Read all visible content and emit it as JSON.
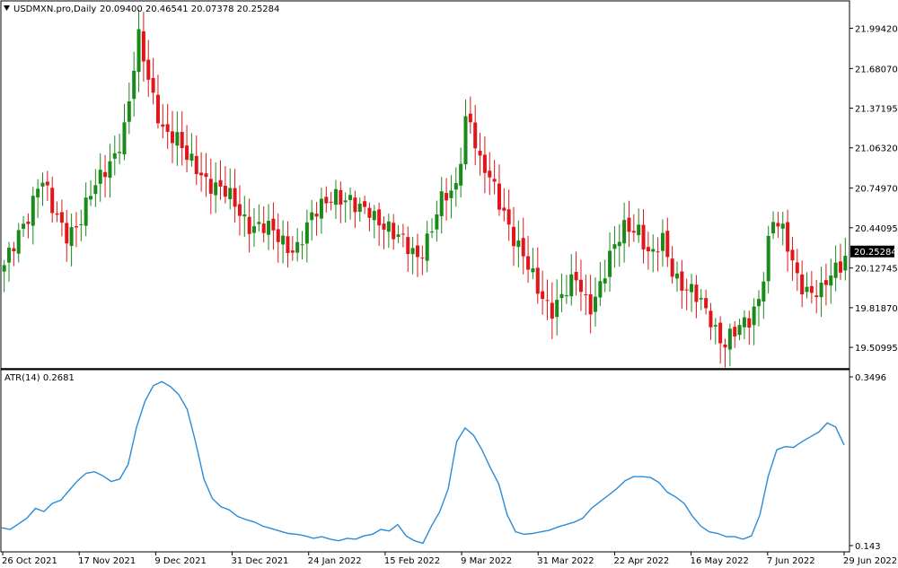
{
  "header": {
    "symbol_line": "USDMXN.pro,Daily",
    "ohlc": "20.09400 20.46541 20.07378 20.25284",
    "menu_icon": "triangle-down-icon"
  },
  "indicator": {
    "label": "ATR(14) 0.2681"
  },
  "colors": {
    "bull": "#1a8a1a",
    "bear": "#e0161b",
    "atr_line": "#2a8bd6",
    "price_tag_bg": "#000000",
    "price_tag_text": "#ffffff",
    "frame": "#000000"
  },
  "chart_data": [
    {
      "type": "candlestick",
      "title": "USDMXN.pro,Daily",
      "ylim": [
        19.35,
        22.2
      ],
      "y_ticks": [
        "21.99420",
        "21.68070",
        "21.37195",
        "21.06320",
        "20.74970",
        "20.44095",
        "20.12745",
        "19.81870",
        "19.50995"
      ],
      "y_tick_values": [
        21.9942,
        21.6807,
        21.37195,
        21.0632,
        20.7497,
        20.44095,
        20.12745,
        19.8187,
        19.50995
      ],
      "current_price": "20.25284",
      "current_price_value": 20.25284,
      "x_labels": [
        "26 Oct 2021",
        "17 Nov 2021",
        "9 Dec 2021",
        "31 Dec 2021",
        "24 Jan 2022",
        "15 Feb 2022",
        "9 Mar 2022",
        "31 Mar 2022",
        "22 Apr 2022",
        "16 May 2022",
        "7 Jun 2022",
        "29 Jun 2022"
      ],
      "close_path": [
        20.15,
        20.3,
        20.55,
        20.9,
        20.55,
        20.35,
        20.5,
        20.7,
        20.8,
        21.0,
        21.3,
        21.9,
        21.5,
        21.25,
        21.15,
        20.95,
        20.9,
        20.8,
        20.7,
        20.6,
        20.5,
        20.45,
        20.38,
        20.33,
        20.3,
        20.45,
        20.6,
        20.75,
        20.65,
        20.55,
        20.6,
        20.5,
        20.35,
        20.3,
        20.25,
        20.4,
        20.65,
        20.75,
        21.4,
        20.9,
        20.8,
        20.6,
        20.3,
        20.1,
        19.95,
        19.82,
        19.9,
        20.05,
        19.85,
        20.0,
        20.25,
        20.5,
        20.45,
        20.15,
        20.35,
        20.1,
        19.95,
        19.85,
        19.75,
        19.55,
        19.6,
        19.7,
        19.95,
        20.5,
        20.35,
        20.1,
        19.95,
        19.9,
        20.1,
        20.25
      ],
      "atr": {
        "label": "ATR(14) 0.2681",
        "ylim": [
          0.143,
          0.3496
        ],
        "y_ticks": [
          "0.3496",
          "0.143"
        ],
        "values": [
          0.166,
          0.164,
          0.171,
          0.178,
          0.19,
          0.186,
          0.196,
          0.2,
          0.212,
          0.224,
          0.233,
          0.235,
          0.23,
          0.223,
          0.226,
          0.244,
          0.29,
          0.322,
          0.341,
          0.346,
          0.34,
          0.33,
          0.312,
          0.272,
          0.226,
          0.202,
          0.192,
          0.188,
          0.18,
          0.176,
          0.173,
          0.168,
          0.165,
          0.162,
          0.159,
          0.158,
          0.156,
          0.153,
          0.155,
          0.152,
          0.15,
          0.153,
          0.152,
          0.156,
          0.158,
          0.164,
          0.162,
          0.17,
          0.156,
          0.15,
          0.147,
          0.168,
          0.186,
          0.214,
          0.272,
          0.289,
          0.28,
          0.262,
          0.24,
          0.22,
          0.182,
          0.161,
          0.158,
          0.159,
          0.161,
          0.163,
          0.167,
          0.17,
          0.173,
          0.178,
          0.19,
          0.198,
          0.206,
          0.214,
          0.224,
          0.229,
          0.229,
          0.228,
          0.222,
          0.21,
          0.204,
          0.196,
          0.18,
          0.168,
          0.161,
          0.159,
          0.155,
          0.155,
          0.152,
          0.156,
          0.182,
          0.23,
          0.262,
          0.266,
          0.265,
          0.272,
          0.278,
          0.284,
          0.295,
          0.29,
          0.268
        ]
      }
    }
  ]
}
